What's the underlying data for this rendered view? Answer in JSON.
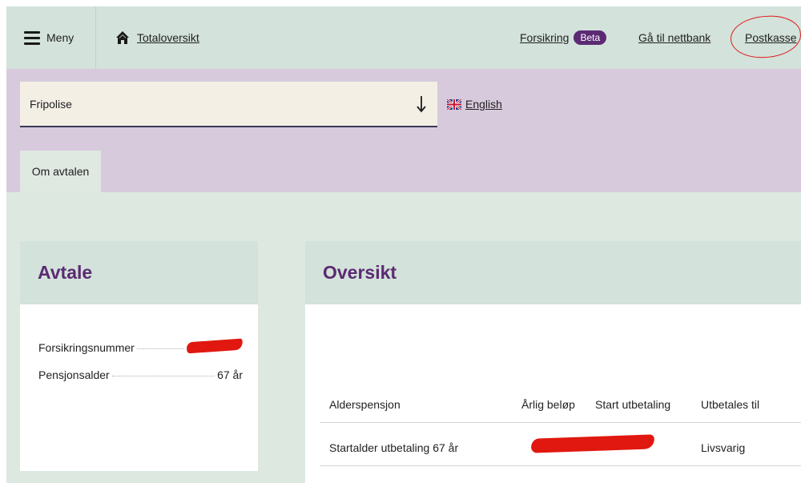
{
  "topbar": {
    "menu_label": "Meny",
    "home_label": "Totaloversikt",
    "insurance_label": "Forsikring",
    "beta_badge": "Beta",
    "netbank_label": "Gå til nettbank",
    "mailbox_label": "Postkasse"
  },
  "policy_select": {
    "value": "Fripolise"
  },
  "language": {
    "label": "English"
  },
  "tabs": [
    {
      "label": "Om avtalen"
    }
  ],
  "agreement": {
    "title": "Avtale",
    "rows": [
      {
        "label": "Forsikringsnummer",
        "value": ""
      },
      {
        "label": "Pensjonsalder",
        "value": "67 år"
      }
    ]
  },
  "overview": {
    "title": "Oversikt",
    "columns": [
      "Alderspensjon",
      "Årlig beløp",
      "Start utbetaling",
      "Utbetales til"
    ],
    "rows": [
      {
        "alderspensjon": "Startalder utbetaling 67 år",
        "arlig_belop": "",
        "start_utbetaling": "",
        "utbetales_til": "Livsvarig"
      }
    ]
  },
  "colors": {
    "accent": "#5b2a73",
    "green_header": "#d3e2da",
    "purple_band": "#d8cadd",
    "redaction": "#e0180f"
  },
  "icons": [
    "hamburger-icon",
    "home-icon",
    "arrow-down-icon",
    "uk-flag-icon"
  ]
}
